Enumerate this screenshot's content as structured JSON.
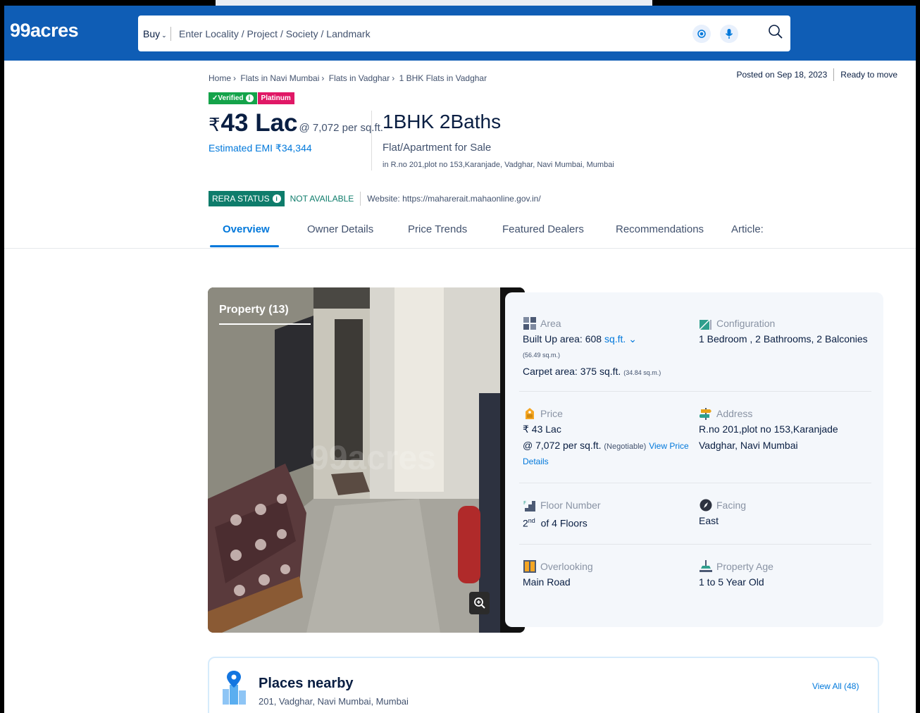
{
  "header": {
    "logo": "99acres",
    "buy_label": "Buy",
    "search_placeholder": "Enter Locality / Project / Society / Landmark"
  },
  "breadcrumb": [
    "Home",
    "Flats in Navi Mumbai",
    "Flats in Vadghar",
    "1 BHK Flats in Vadghar"
  ],
  "posted": "Posted on Sep 18, 2023",
  "ready": "Ready to move",
  "badges": {
    "verified": "Verified",
    "platinum": "Platinum"
  },
  "price": {
    "symbol": "₹",
    "amount": "43 Lac",
    "per_sqft": "@ 7,072 per sq.ft.",
    "emi": "Estimated EMI ₹34,344"
  },
  "config": {
    "title": "1BHK 2Baths",
    "subtitle": "Flat/Apartment for Sale",
    "address": "in R.no 201,plot no 153,Karanjade, Vadghar, Navi Mumbai, Mumbai"
  },
  "rera": {
    "status_label": "RERA STATUS",
    "status_value": "NOT AVAILABLE",
    "website": "Website: https://maharerait.mahaonline.gov.in/"
  },
  "tabs": [
    {
      "label": "Overview"
    },
    {
      "label": "Owner Details"
    },
    {
      "label": "Price Trends"
    },
    {
      "label": "Featured Dealers"
    },
    {
      "label": "Recommendations"
    },
    {
      "label": "Article:"
    }
  ],
  "photo": {
    "label": "Property (13)",
    "watermark": "99acres"
  },
  "details": {
    "area": {
      "label": "Area",
      "builtup": "Built Up area: 608",
      "unit": "sq.ft.",
      "builtup_sqm": "(56.49 sq.m.)",
      "carpet": "Carpet area: 375 sq.ft.",
      "carpet_sqm": "(34.84 sq.m.)"
    },
    "configuration": {
      "label": "Configuration",
      "value": "1 Bedroom , 2 Bathrooms, 2 Balconies"
    },
    "price": {
      "label": "Price",
      "value": "₹ 43 Lac",
      "per_sqft": "@ 7,072 per sq.ft.",
      "negotiable": "(Negotiable)",
      "link1": "View Price",
      "link2": "Details"
    },
    "address": {
      "label": "Address",
      "line1": "R.no 201,plot no 153,Karanjade",
      "line2": "Vadghar, Navi Mumbai"
    },
    "floor": {
      "label": "Floor Number",
      "num": "2",
      "sup": "nd",
      "of": "of 4 Floors"
    },
    "facing": {
      "label": "Facing",
      "value": "East"
    },
    "overlooking": {
      "label": "Overlooking",
      "value": "Main Road"
    },
    "age": {
      "label": "Property Age",
      "value": "1 to 5 Year Old"
    }
  },
  "places": {
    "title": "Places nearby",
    "address": "201, Vadghar, Navi Mumbai, Mumbai",
    "view_all": "View All (48)"
  },
  "colors": {
    "brand_blue": "#0F5DB5",
    "link_blue": "#0078DB",
    "verified_green": "#14A34A",
    "platinum_pink": "#E01866",
    "rera_teal": "#0E7C6B"
  }
}
